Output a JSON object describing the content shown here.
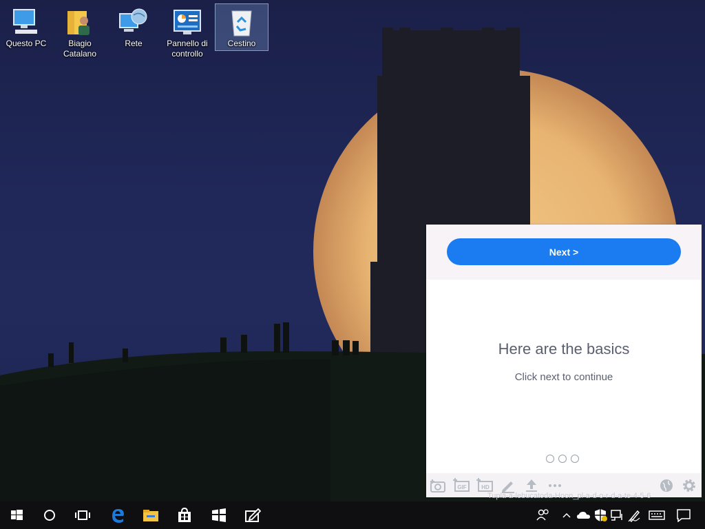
{
  "desktop": {
    "icons": [
      {
        "label": "Questo PC",
        "name": "this-pc-icon"
      },
      {
        "label": "Biagio\nCatalano",
        "name": "user-folder-icon"
      },
      {
        "label": "Rete",
        "name": "network-icon"
      },
      {
        "label": "Pannello di\ncontrollo",
        "name": "control-panel-icon"
      },
      {
        "label": "Cestino",
        "name": "recycle-bin-icon"
      }
    ],
    "selected_icon": "Cestino"
  },
  "tour_panel": {
    "next_label": "Next >",
    "title": "Here are the basics",
    "subtitle": "Click next to continue",
    "steps_total": 3,
    "toolbar_icons": [
      "camera-icon",
      "gif-icon",
      "hd-icon",
      "pen-icon",
      "upload-icon",
      "more-icon",
      "globe-icon",
      "gear-icon"
    ],
    "accent_color": "#1a7cf0"
  },
  "watermark": "Tupla-a-lebucatoda-Hoon_pl-a-d-o-r-d-a-te-4-5-6",
  "taskbar": {
    "buttons": [
      "start-icon",
      "cortana-icon",
      "task-view-icon",
      "edge-icon",
      "file-explorer-icon",
      "store-icon",
      "app-icon",
      "notes-icon"
    ],
    "tray": [
      "people-icon",
      "chevron-up-icon",
      "onedrive-icon",
      "defender-icon",
      "network-tray-icon",
      "pen-tray-icon",
      "keyboard-icon",
      "notification-icon"
    ]
  }
}
